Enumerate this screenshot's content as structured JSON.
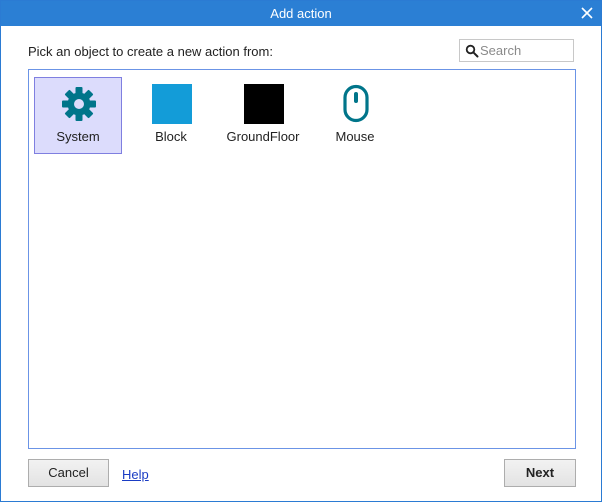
{
  "dialog": {
    "title": "Add action",
    "prompt": "Pick an object to create a new action from:",
    "search": {
      "placeholder": "Search",
      "value": ""
    },
    "objects": [
      {
        "label": "System",
        "icon": "gear-icon",
        "color": "#00758a",
        "selected": true
      },
      {
        "label": "Block",
        "icon": "blue-square-sprite",
        "color": "#139cd8",
        "selected": false
      },
      {
        "label": "GroundFloor",
        "icon": "black-square-sprite",
        "color": "#000000",
        "selected": false
      },
      {
        "label": "Mouse",
        "icon": "mouse-icon",
        "color": "#00758a",
        "selected": false
      }
    ],
    "buttons": {
      "cancel": "Cancel",
      "help": "Help",
      "next": "Next"
    }
  },
  "colors": {
    "titlebar": "#2b7fd4",
    "selection": "#dcdcfc",
    "list_border": "#6b94e6",
    "link": "#1a3cc4"
  }
}
